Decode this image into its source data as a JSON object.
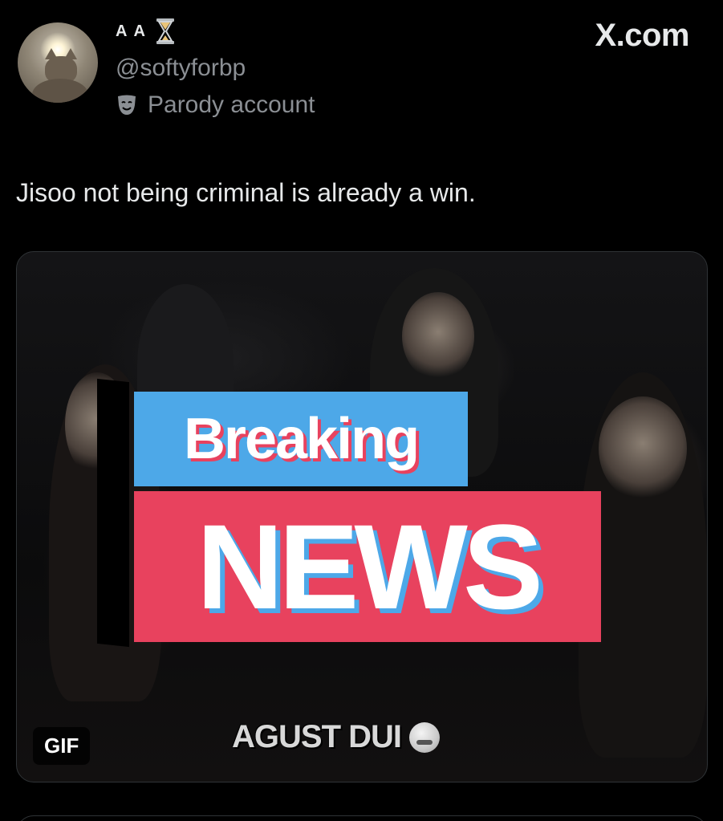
{
  "header": {
    "display_name": "A A",
    "handle": "@softyforbp",
    "parody_label": "Parody account",
    "source_brand": "X.com"
  },
  "tweet": {
    "text": "Jisoo not being criminal is already a win."
  },
  "media": {
    "type": "GIF",
    "badge_label": "GIF",
    "overlay_top": "Breaking",
    "overlay_bottom": "NEWS",
    "caption": "AGUST DUI",
    "colors": {
      "blue_banner": "#4da8e8",
      "red_banner": "#e8425e"
    }
  },
  "icons": {
    "name_badge": "hourglass-icon",
    "parody": "theater-mask-icon",
    "caption_emoji": "grimacing-face-icon"
  }
}
